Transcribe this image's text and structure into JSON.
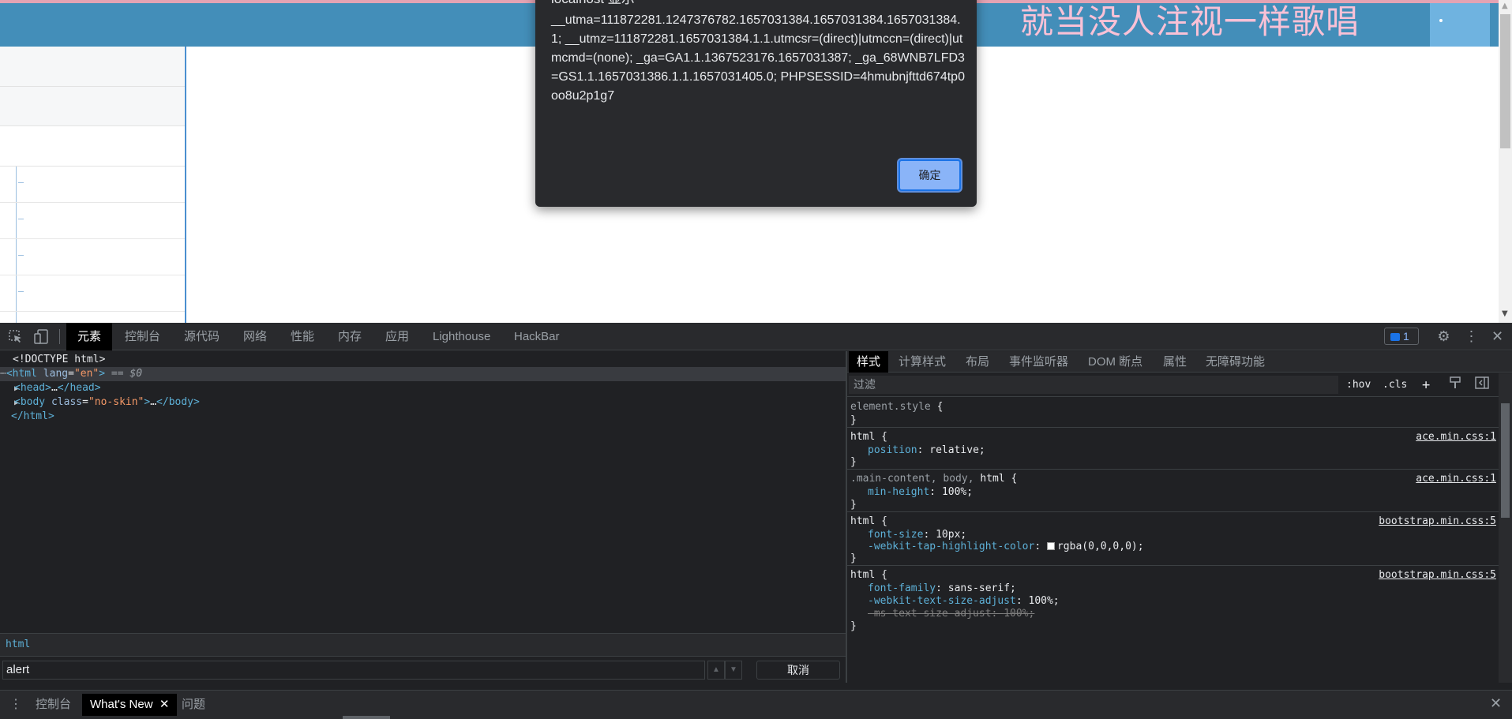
{
  "page": {
    "banner_text": "就当没人注视一样歌唱"
  },
  "alert": {
    "title": "localhost 显示",
    "message": "__utma=111872281.1247376782.1657031384.1657031384.1657031384.1; __utmz=111872281.1657031384.1.1.utmcsr=(direct)|utmccn=(direct)|utmcmd=(none); _ga=GA1.1.1367523176.1657031387; _ga_68WNB7LFD3=GS1.1.1657031386.1.1.1657031405.0; PHPSESSID=4hmubnjfttd674tp0oo8u2p1g7",
    "ok_label": "确定"
  },
  "devtools": {
    "tabs": [
      "元素",
      "控制台",
      "源代码",
      "网络",
      "性能",
      "内存",
      "应用",
      "Lighthouse",
      "HackBar"
    ],
    "issues_count": "1",
    "dom": {
      "doctype": "<!DOCTYPE html>",
      "html_open_tag": "<html",
      "html_lang_attr": "lang",
      "html_lang_value": "\"en\"",
      "html_close_bracket": ">",
      "selected_marker": "== $0",
      "head_tag": "<head>",
      "head_ellipsis": "…",
      "head_close": "</head>",
      "body_open": "<body",
      "body_class_attr": "class",
      "body_class_value": "\"no-skin\"",
      "body_gt": ">",
      "body_ellipsis": "…",
      "body_close": "</body>",
      "html_close": "</html>"
    },
    "breadcrumb": "html",
    "search": {
      "value": "alert",
      "cancel_label": "取消"
    },
    "styles_tabs": [
      "样式",
      "计算样式",
      "布局",
      "事件监听器",
      "DOM 断点",
      "属性",
      "无障碍功能"
    ],
    "filter_placeholder": "过滤",
    "filter_buttons": {
      "hov": ":hov",
      "cls": ".cls",
      "add": "+"
    },
    "rules": [
      {
        "selector": "element.style",
        "open": "{",
        "close": "}"
      },
      {
        "selector": "html",
        "source": "ace.min.css:1",
        "props": [
          {
            "name": "position",
            "value": "relative;"
          }
        ]
      },
      {
        "selector_dim": ".main-content, body,",
        "selector": "html",
        "source": "ace.min.css:1",
        "props": [
          {
            "name": "min-height",
            "value": "100%;"
          }
        ]
      },
      {
        "selector": "html",
        "source": "bootstrap.min.css:5",
        "props": [
          {
            "name": "font-size",
            "value": "10px;"
          },
          {
            "name": "-webkit-tap-highlight-color",
            "value": "rgba(0,0,0,0);"
          }
        ]
      },
      {
        "selector": "html",
        "source": "bootstrap.min.css:5",
        "props": [
          {
            "name": "font-family",
            "value": "sans-serif;"
          },
          {
            "name": "-webkit-text-size-adjust",
            "value": "100%;"
          },
          {
            "name": "-ms-text-size-adjust",
            "value": "100%;"
          }
        ]
      }
    ],
    "drawer_tabs": [
      "控制台",
      "What's New",
      "问题"
    ]
  },
  "colors": {
    "banner": "#438eb9",
    "banner_text": "#f9c1d6",
    "alert_bg": "#292a2d",
    "devtools_bg": "#202124",
    "accent": "#8ab4f8"
  }
}
